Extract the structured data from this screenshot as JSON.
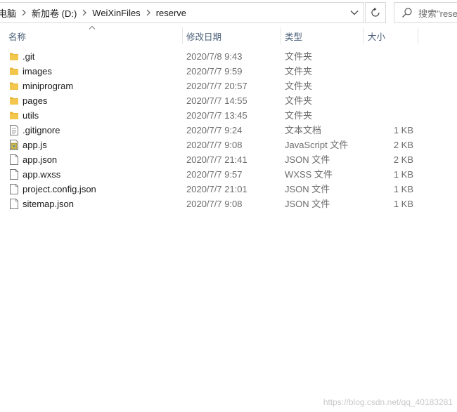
{
  "address": {
    "crumbs": [
      "电脑",
      "新加卷 (D:)",
      "WeiXinFiles",
      "reserve"
    ]
  },
  "search": {
    "placeholder": "搜索\"rese"
  },
  "columns": {
    "name": "名称",
    "date": "修改日期",
    "type": "类型",
    "size": "大小"
  },
  "files": [
    {
      "name": ".git",
      "date": "2020/7/8 9:43",
      "type": "文件夹",
      "size": "",
      "icon": "folder-icon"
    },
    {
      "name": "images",
      "date": "2020/7/7 9:59",
      "type": "文件夹",
      "size": "",
      "icon": "folder-icon"
    },
    {
      "name": "miniprogram",
      "date": "2020/7/7 20:57",
      "type": "文件夹",
      "size": "",
      "icon": "folder-icon"
    },
    {
      "name": "pages",
      "date": "2020/7/7 14:55",
      "type": "文件夹",
      "size": "",
      "icon": "folder-icon"
    },
    {
      "name": "utils",
      "date": "2020/7/7 13:45",
      "type": "文件夹",
      "size": "",
      "icon": "folder-icon"
    },
    {
      "name": ".gitignore",
      "date": "2020/7/7 9:24",
      "type": "文本文档",
      "size": "1 KB",
      "icon": "text-file-icon"
    },
    {
      "name": "app.js",
      "date": "2020/7/7 9:08",
      "type": "JavaScript 文件",
      "size": "2 KB",
      "icon": "javascript-file-icon"
    },
    {
      "name": "app.json",
      "date": "2020/7/7 21:41",
      "type": "JSON 文件",
      "size": "2 KB",
      "icon": "file-icon"
    },
    {
      "name": "app.wxss",
      "date": "2020/7/7 9:57",
      "type": "WXSS 文件",
      "size": "1 KB",
      "icon": "file-icon"
    },
    {
      "name": "project.config.json",
      "date": "2020/7/7 21:01",
      "type": "JSON 文件",
      "size": "1 KB",
      "icon": "file-icon"
    },
    {
      "name": "sitemap.json",
      "date": "2020/7/7 9:08",
      "type": "JSON 文件",
      "size": "1 KB",
      "icon": "file-icon"
    }
  ],
  "watermark": "https://blog.csdn.net/qq_40183281",
  "colors": {
    "folder": "#e8b53a",
    "header_text": "#4c607a",
    "secondary_text": "#6d6d6d"
  }
}
